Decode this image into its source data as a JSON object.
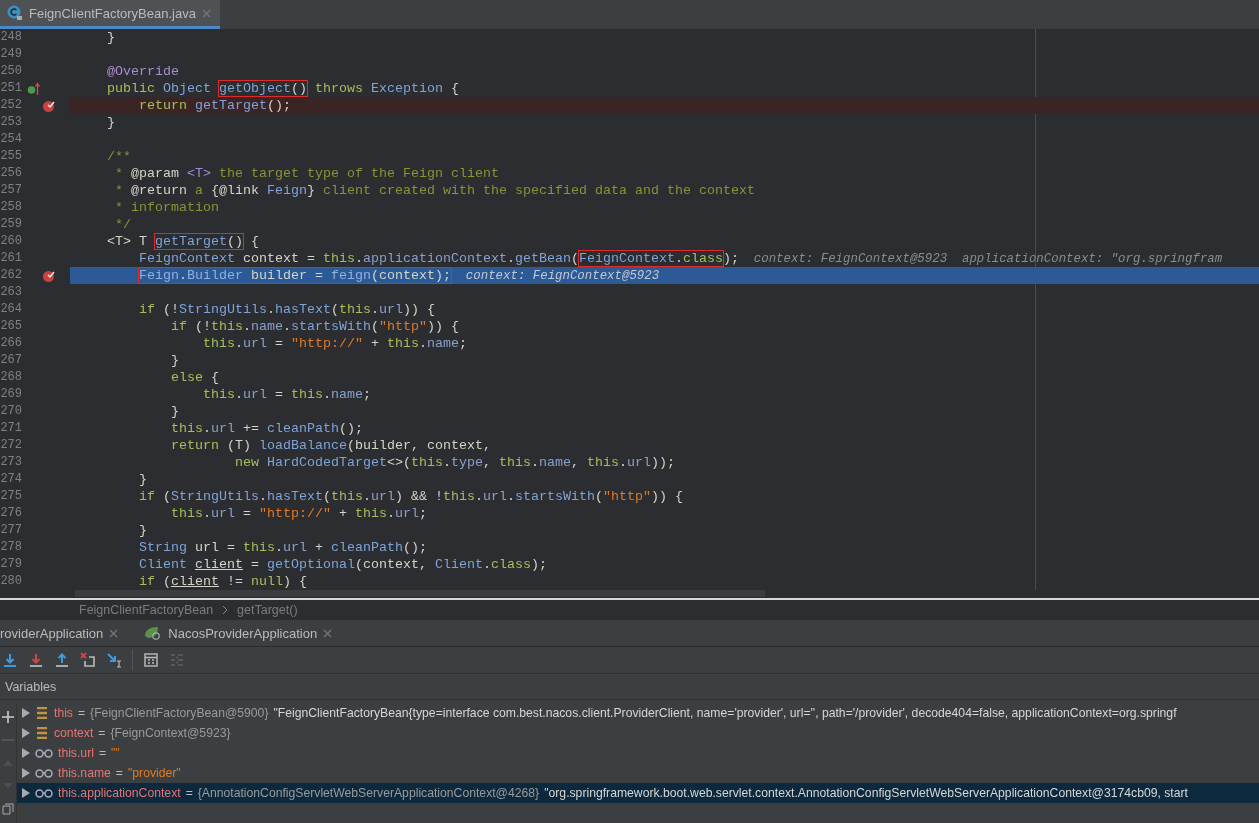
{
  "editor_tab": {
    "label": "FeignClientFactoryBean.java",
    "selected": true
  },
  "lines": [
    {
      "n": "248",
      "kind": "code",
      "spans": [
        {
          "t": "    }",
          "kind": "p"
        }
      ]
    },
    {
      "n": "249",
      "kind": "code"
    },
    {
      "n": "250",
      "kind": "code",
      "spans": [
        {
          "t": "    @Override",
          "kind": "a"
        }
      ]
    },
    {
      "n": "251",
      "kind": "override",
      "spans": [
        {
          "t": "    public ",
          "kind": "k"
        },
        {
          "t": "Object ",
          "kind": "t"
        },
        {
          "kind": "box",
          "spans": [
            {
              "t": "getObject",
              "kind": "t"
            },
            {
              "t": "()",
              "kind": "p"
            }
          ]
        },
        {
          "t": " throws ",
          "kind": "k"
        },
        {
          "t": "Exception ",
          "kind": "t"
        },
        {
          "t": "{",
          "kind": "p"
        }
      ]
    },
    {
      "n": "252",
      "kind": "breakpoint",
      "spans": [
        {
          "t": "        return ",
          "kind": "k"
        },
        {
          "t": "getTarget",
          "kind": "t"
        },
        {
          "t": "();",
          "kind": "p"
        }
      ]
    },
    {
      "n": "253",
      "kind": "code",
      "spans": [
        {
          "t": "    }",
          "kind": "p"
        }
      ]
    },
    {
      "n": "254",
      "kind": "code"
    },
    {
      "n": "255",
      "kind": "code",
      "spans": [
        {
          "t": "    /**",
          "kind": "c"
        }
      ]
    },
    {
      "n": "256",
      "kind": "code",
      "spans": [
        {
          "t": "     * ",
          "kind": "c"
        },
        {
          "t": "@param ",
          "kind": "d"
        },
        {
          "t": "<T>",
          "kind": "g"
        },
        {
          "t": " the target type of the Feign client",
          "kind": "c"
        }
      ]
    },
    {
      "n": "257",
      "kind": "code",
      "spans": [
        {
          "t": "     * ",
          "kind": "c"
        },
        {
          "t": "@return",
          "kind": "d"
        },
        {
          "t": " a ",
          "kind": "c"
        },
        {
          "t": "{@link ",
          "kind": "d"
        },
        {
          "t": "Feign",
          "kind": "t"
        },
        {
          "t": "}",
          "kind": "d"
        },
        {
          "t": " client created with the specified data and the context",
          "kind": "c"
        }
      ]
    },
    {
      "n": "258",
      "kind": "code",
      "spans": [
        {
          "t": "     * information",
          "kind": "c"
        }
      ]
    },
    {
      "n": "259",
      "kind": "code",
      "spans": [
        {
          "t": "     */",
          "kind": "c"
        }
      ]
    },
    {
      "n": "260",
      "kind": "code",
      "spans": [
        {
          "t": "    <T> T ",
          "kind": "p"
        },
        {
          "kind": "box",
          "spans": [
            {
              "t": "getTarget",
              "kind": "t"
            },
            {
              "t": "()",
              "kind": "p"
            }
          ]
        },
        {
          "t": " {",
          "kind": "p"
        }
      ]
    },
    {
      "n": "261",
      "kind": "code",
      "spans": [
        {
          "t": "        FeignContext",
          "kind": "t"
        },
        {
          "t": " context = ",
          "kind": "p"
        },
        {
          "t": "this",
          "kind": "k"
        },
        {
          "t": ".",
          "kind": "p"
        },
        {
          "t": "applicationContext",
          "kind": "f"
        },
        {
          "t": ".",
          "kind": "p"
        },
        {
          "t": "getBean",
          "kind": "t"
        },
        {
          "t": "(",
          "kind": "p"
        },
        {
          "kind": "box",
          "spans": [
            {
              "t": "FeignContext",
              "kind": "t"
            },
            {
              "t": ".",
              "kind": "p"
            },
            {
              "t": "class",
              "kind": "k"
            }
          ]
        },
        {
          "t": ");",
          "kind": "p"
        },
        {
          "t": "  context: FeignContext@5923  applicationContext: \"org.springfram",
          "kind": "h"
        }
      ]
    },
    {
      "n": "262",
      "kind": "current",
      "spans": [
        {
          "kind": "box",
          "spans": [
            {
              "t": "        Feign",
              "kind": "t"
            },
            {
              "t": ".",
              "kind": "p"
            },
            {
              "t": "Builder",
              "kind": "t"
            },
            {
              "t": " builder = ",
              "kind": "p"
            },
            {
              "t": "feign",
              "kind": "t"
            },
            {
              "t": "(context);",
              "kind": "p"
            }
          ]
        },
        {
          "t": "  context: FeignContext@5923",
          "kind": "h"
        }
      ]
    },
    {
      "n": "263",
      "kind": "code"
    },
    {
      "n": "264",
      "kind": "code",
      "spans": [
        {
          "t": "        if ",
          "kind": "k"
        },
        {
          "t": "(!",
          "kind": "p"
        },
        {
          "t": "StringUtils",
          "kind": "t"
        },
        {
          "t": ".",
          "kind": "p"
        },
        {
          "t": "hasText",
          "kind": "t"
        },
        {
          "t": "(",
          "kind": "p"
        },
        {
          "t": "this",
          "kind": "k"
        },
        {
          "t": ".",
          "kind": "p"
        },
        {
          "t": "url",
          "kind": "f"
        },
        {
          "t": ")) {",
          "kind": "p"
        }
      ]
    },
    {
      "n": "265",
      "kind": "code",
      "spans": [
        {
          "t": "            if ",
          "kind": "k"
        },
        {
          "t": "(!",
          "kind": "p"
        },
        {
          "t": "this",
          "kind": "k"
        },
        {
          "t": ".",
          "kind": "p"
        },
        {
          "t": "name",
          "kind": "f"
        },
        {
          "t": ".",
          "kind": "p"
        },
        {
          "t": "startsWith",
          "kind": "t"
        },
        {
          "t": "(",
          "kind": "p"
        },
        {
          "t": "\"http\"",
          "kind": "s"
        },
        {
          "t": ")) {",
          "kind": "p"
        }
      ]
    },
    {
      "n": "266",
      "kind": "code",
      "spans": [
        {
          "t": "                this",
          "kind": "k"
        },
        {
          "t": ".",
          "kind": "p"
        },
        {
          "t": "url",
          "kind": "f"
        },
        {
          "t": " = ",
          "kind": "p"
        },
        {
          "t": "\"http://\"",
          "kind": "s"
        },
        {
          "t": " + ",
          "kind": "p"
        },
        {
          "t": "this",
          "kind": "k"
        },
        {
          "t": ".",
          "kind": "p"
        },
        {
          "t": "name",
          "kind": "f"
        },
        {
          "t": ";",
          "kind": "p"
        }
      ]
    },
    {
      "n": "267",
      "kind": "code",
      "spans": [
        {
          "t": "            }",
          "kind": "p"
        }
      ]
    },
    {
      "n": "268",
      "kind": "code",
      "spans": [
        {
          "t": "            else ",
          "kind": "k"
        },
        {
          "t": "{",
          "kind": "p"
        }
      ]
    },
    {
      "n": "269",
      "kind": "code",
      "spans": [
        {
          "t": "                this",
          "kind": "k"
        },
        {
          "t": ".",
          "kind": "p"
        },
        {
          "t": "url",
          "kind": "f"
        },
        {
          "t": " = ",
          "kind": "p"
        },
        {
          "t": "this",
          "kind": "k"
        },
        {
          "t": ".",
          "kind": "p"
        },
        {
          "t": "name",
          "kind": "f"
        },
        {
          "t": ";",
          "kind": "p"
        }
      ]
    },
    {
      "n": "270",
      "kind": "code",
      "spans": [
        {
          "t": "            }",
          "kind": "p"
        }
      ]
    },
    {
      "n": "271",
      "kind": "code",
      "spans": [
        {
          "t": "            this",
          "kind": "k"
        },
        {
          "t": ".",
          "kind": "p"
        },
        {
          "t": "url",
          "kind": "f"
        },
        {
          "t": " += ",
          "kind": "p"
        },
        {
          "t": "cleanPath",
          "kind": "t"
        },
        {
          "t": "();",
          "kind": "p"
        }
      ]
    },
    {
      "n": "272",
      "kind": "code",
      "spans": [
        {
          "t": "            return ",
          "kind": "k"
        },
        {
          "t": "(T) ",
          "kind": "p"
        },
        {
          "t": "loadBalance",
          "kind": "t"
        },
        {
          "t": "(builder, context,",
          "kind": "p"
        }
      ]
    },
    {
      "n": "273",
      "kind": "code",
      "spans": [
        {
          "t": "                    new ",
          "kind": "k"
        },
        {
          "t": "HardCodedTarget",
          "kind": "t"
        },
        {
          "t": "<>(",
          "kind": "p"
        },
        {
          "t": "this",
          "kind": "k"
        },
        {
          "t": ".",
          "kind": "p"
        },
        {
          "t": "type",
          "kind": "f"
        },
        {
          "t": ", ",
          "kind": "p"
        },
        {
          "t": "this",
          "kind": "k"
        },
        {
          "t": ".",
          "kind": "p"
        },
        {
          "t": "name",
          "kind": "f"
        },
        {
          "t": ", ",
          "kind": "p"
        },
        {
          "t": "this",
          "kind": "k"
        },
        {
          "t": ".",
          "kind": "p"
        },
        {
          "t": "url",
          "kind": "f"
        },
        {
          "t": "));",
          "kind": "p"
        }
      ]
    },
    {
      "n": "274",
      "kind": "code",
      "spans": [
        {
          "t": "        }",
          "kind": "p"
        }
      ]
    },
    {
      "n": "275",
      "kind": "code",
      "spans": [
        {
          "t": "        if ",
          "kind": "k"
        },
        {
          "t": "(",
          "kind": "p"
        },
        {
          "t": "StringUtils",
          "kind": "t"
        },
        {
          "t": ".",
          "kind": "p"
        },
        {
          "t": "hasText",
          "kind": "t"
        },
        {
          "t": "(",
          "kind": "p"
        },
        {
          "t": "this",
          "kind": "k"
        },
        {
          "t": ".",
          "kind": "p"
        },
        {
          "t": "url",
          "kind": "f"
        },
        {
          "t": ") && !",
          "kind": "p"
        },
        {
          "t": "this",
          "kind": "k"
        },
        {
          "t": ".",
          "kind": "p"
        },
        {
          "t": "url",
          "kind": "f"
        },
        {
          "t": ".",
          "kind": "p"
        },
        {
          "t": "startsWith",
          "kind": "t"
        },
        {
          "t": "(",
          "kind": "p"
        },
        {
          "t": "\"http\"",
          "kind": "s"
        },
        {
          "t": ")) {",
          "kind": "p"
        }
      ]
    },
    {
      "n": "276",
      "kind": "code",
      "spans": [
        {
          "t": "            this",
          "kind": "k"
        },
        {
          "t": ".",
          "kind": "p"
        },
        {
          "t": "url",
          "kind": "f"
        },
        {
          "t": " = ",
          "kind": "p"
        },
        {
          "t": "\"http://\"",
          "kind": "s"
        },
        {
          "t": " + ",
          "kind": "p"
        },
        {
          "t": "this",
          "kind": "k"
        },
        {
          "t": ".",
          "kind": "p"
        },
        {
          "t": "url",
          "kind": "f"
        },
        {
          "t": ";",
          "kind": "p"
        }
      ]
    },
    {
      "n": "277",
      "kind": "code",
      "spans": [
        {
          "t": "        }",
          "kind": "p"
        }
      ]
    },
    {
      "n": "278",
      "kind": "code",
      "spans": [
        {
          "t": "        String",
          "kind": "t"
        },
        {
          "t": " url = ",
          "kind": "p"
        },
        {
          "t": "this",
          "kind": "k"
        },
        {
          "t": ".",
          "kind": "p"
        },
        {
          "t": "url",
          "kind": "f"
        },
        {
          "t": " + ",
          "kind": "p"
        },
        {
          "t": "cleanPath",
          "kind": "t"
        },
        {
          "t": "();",
          "kind": "p"
        }
      ]
    },
    {
      "n": "279",
      "kind": "code",
      "spans": [
        {
          "t": "        Client ",
          "kind": "t"
        },
        {
          "t": "client",
          "kind": "u"
        },
        {
          "t": " = ",
          "kind": "p"
        },
        {
          "t": "getOptional",
          "kind": "t"
        },
        {
          "t": "(context, ",
          "kind": "p"
        },
        {
          "t": "Client",
          "kind": "t"
        },
        {
          "t": ".",
          "kind": "p"
        },
        {
          "t": "class",
          "kind": "k"
        },
        {
          "t": ");",
          "kind": "p"
        }
      ]
    },
    {
      "n": "280",
      "kind": "code",
      "spans": [
        {
          "t": "        if ",
          "kind": "k"
        },
        {
          "t": "(",
          "kind": "p"
        },
        {
          "t": "client",
          "kind": "u"
        },
        {
          "t": " != ",
          "kind": "p"
        },
        {
          "t": "null",
          "kind": "k"
        },
        {
          "t": ") {",
          "kind": "p"
        }
      ]
    }
  ],
  "breadcrumb": [
    "FeignClientFactoryBean",
    "getTarget()"
  ],
  "debug_tabs": [
    {
      "label": "roviderApplication"
    },
    {
      "label": "NacosProviderApplication"
    }
  ],
  "variables_title": "Variables",
  "variables": [
    {
      "kind": "field",
      "name": "this",
      "op": "=",
      "value": [
        {
          "t": "{FeignClientFactoryBean@5900}",
          "kind": "ref"
        },
        {
          "t": "\"FeignClientFactoryBean{type=interface com.best.nacos.client.ProviderClient, name='provider', url='', path='/provider', decode404=false, applicationContext=org.springf",
          "kind": "text"
        }
      ],
      "selected": false
    },
    {
      "kind": "field",
      "name": "context",
      "op": "=",
      "value": [
        {
          "t": "{FeignContext@5923}",
          "kind": "ref"
        }
      ],
      "selected": false
    },
    {
      "kind": "watch",
      "name": "this.url",
      "op": "=",
      "value": [
        {
          "t": "\"\"",
          "kind": "str"
        }
      ],
      "selected": false
    },
    {
      "kind": "watch",
      "name": "this.name",
      "op": "=",
      "value": [
        {
          "t": "\"provider\"",
          "kind": "str"
        }
      ],
      "selected": false
    },
    {
      "kind": "watch",
      "name": "this.applicationContext",
      "op": "=",
      "value": [
        {
          "t": "{AnnotationConfigServletWebServerApplicationContext@4268}",
          "kind": "ref"
        },
        {
          "t": "\"org.springframework.boot.web.servlet.context.AnnotationConfigServletWebServerApplicationContext@3174cb09, start",
          "kind": "text"
        }
      ],
      "selected": true
    }
  ]
}
